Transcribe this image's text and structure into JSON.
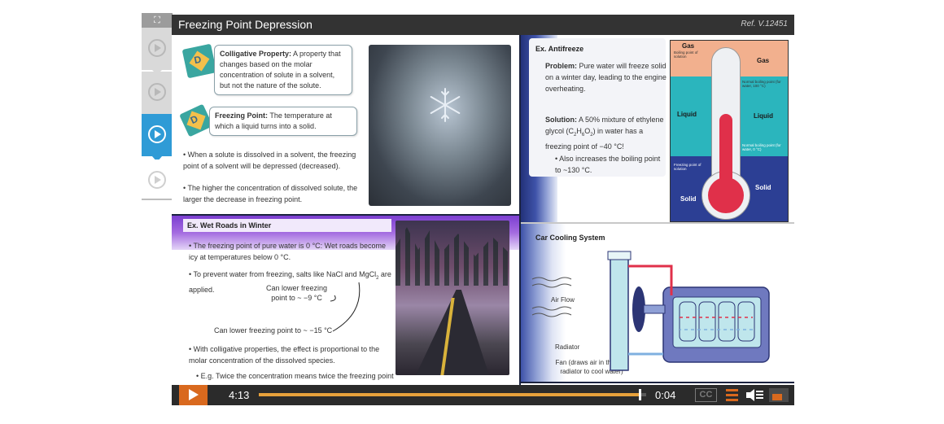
{
  "player": {
    "title": "Freezing Point Depression",
    "ref": "Ref. V.12451",
    "current_time": "4:13",
    "remaining_time": "0:04",
    "progress": 0.984,
    "cc_label": "CC",
    "accent_color": "#d9691e"
  },
  "sidenav": {
    "expand_icon": "expand-icon",
    "items": [
      {
        "state": "done",
        "icon": "play-circle-icon"
      },
      {
        "state": "done",
        "icon": "play-circle-icon"
      },
      {
        "state": "active",
        "icon": "play-circle-icon"
      },
      {
        "state": "pending",
        "icon": "play-circle-icon"
      }
    ]
  },
  "slide": {
    "colligative": {
      "term": "Colligative Property:",
      "text": " A property that changes based on the molar concentration of solute in a solvent, but not the nature of the solute."
    },
    "freezing_point": {
      "term": "Freezing Point:",
      "text": " The temperature at which a liquid turns into a solid."
    },
    "bullets_top": [
      "• When a solute is dissolved in a solvent, the freezing point of a solvent will be depressed (decreased).",
      "• The higher the concentration of dissolved solute, the larger the decrease in freezing point."
    ],
    "wet_roads": {
      "heading": "Ex. Wet Roads in Winter",
      "b1": "• The freezing point of pure water is 0 °C: Wet roads become icy at temperatures below 0 °C.",
      "b2a": "• To prevent water from freezing, salts like NaCl and MgCl",
      "b2sub": "2",
      "b2b": " are applied.",
      "note1a": "Can lower freezing",
      "note1b": "point to ~ −9 °C",
      "note2": "Can lower freezing point to ~ −15 °C",
      "b3": "• With colligative properties, the effect is proportional to the molar concentration of the dissolved species.",
      "b4": "• E.g. Twice the concentration means twice the freezing point decrease!"
    },
    "antifreeze": {
      "heading": "Ex. Antifreeze",
      "problem_term": "Problem:",
      "problem_text": " Pure water will freeze solid on a winter day, leading to the engine overheating.",
      "solution_term": "Solution:",
      "solution_text_a": " A 50% mixture of ethylene glycol (C",
      "solution_sub1": "2",
      "solution_text_b": "H",
      "solution_sub2": "6",
      "solution_text_c": "O",
      "solution_sub3": "2",
      "solution_text_d": ") in water has a freezing point of −40 °C!",
      "extra": "• Also increases the boiling point to ~130 °C."
    },
    "thermometer": {
      "gas_left": "Gas",
      "gas_right": "Gas",
      "liquid_left": "Liquid",
      "liquid_right": "Liquid",
      "solid_left": "Solid",
      "solid_right": "Solid",
      "boiling_point_solution": "Boiling point of solution",
      "normal_boiling_point": "Normal boiling point (for water, 100 °C)",
      "normal_freezing_point": "Normal boiling point (for water, 0 °C)",
      "freezing_point_solution": "Freezing point of solution",
      "colors": {
        "gas": "#f2b08e",
        "liquid": "#2bb5bd",
        "solid": "#2c3f94",
        "mercury": "#e0304a"
      }
    },
    "cooling": {
      "heading": "Car Cooling System",
      "air_flow": "Air Flow",
      "radiator": "Radiator",
      "fan_a": "Fan (draws air in through",
      "fan_b": "radiator to cool water)"
    }
  }
}
